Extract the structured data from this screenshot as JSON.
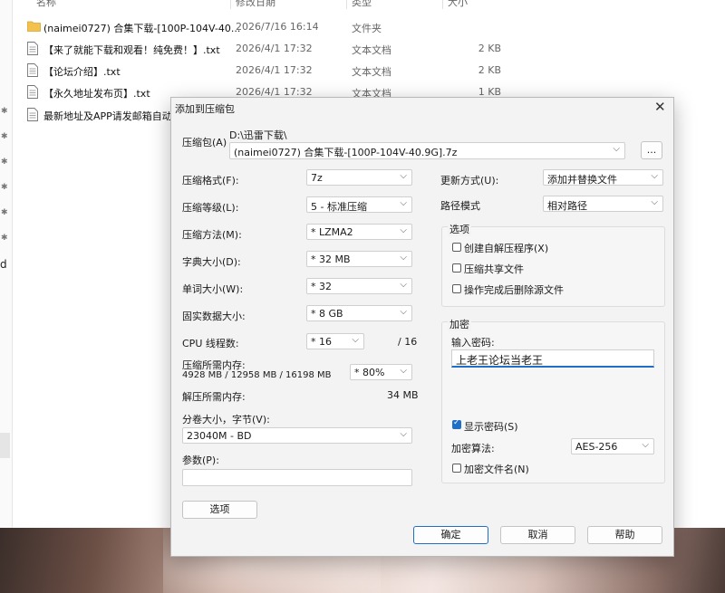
{
  "explorer": {
    "columns": {
      "name": "名称",
      "date": "修改日期",
      "type": "类型",
      "size": "大小"
    },
    "nav_letter": "d",
    "files": [
      {
        "name": "(naimei0727) 合集下载-[100P-104V-40...",
        "date": "2026/7/16 16:14",
        "type": "文件夹",
        "size": "",
        "icon": "folder-icon"
      },
      {
        "name": "【来了就能下载和观看！纯免费！】.txt",
        "date": "2026/4/1 17:32",
        "type": "文本文档",
        "size": "2 KB",
        "icon": "text-file-icon"
      },
      {
        "name": "【论坛介绍】.txt",
        "date": "2026/4/1 17:32",
        "type": "文本文档",
        "size": "2 KB",
        "icon": "text-file-icon"
      },
      {
        "name": "【永久地址发布页】.txt",
        "date": "2026/4/1 17:32",
        "type": "文本文档",
        "size": "1 KB",
        "icon": "text-file-icon"
      },
      {
        "name": "最新地址及APP请发邮箱自动",
        "date": "",
        "type": "",
        "size": "",
        "icon": "text-file-icon"
      }
    ]
  },
  "dialog": {
    "title": "添加到压缩包",
    "archive_label": "压缩包(A)",
    "archive_path": "D:\\迅雷下载\\",
    "archive_name": "(naimei0727) 合集下载-[100P-104V-40.9G].7z",
    "browse_label": "...",
    "left": [
      {
        "label": "压缩格式(F):",
        "value": "7z"
      },
      {
        "label": "压缩等级(L):",
        "value": "5 - 标准压缩"
      },
      {
        "label": "压缩方法(M):",
        "value": "* LZMA2"
      },
      {
        "label": "字典大小(D):",
        "value": "* 32 MB"
      },
      {
        "label": "单词大小(W):",
        "value": "* 32"
      },
      {
        "label": "固实数据大小:",
        "value": "* 8 GB"
      }
    ],
    "cpu_label": "CPU 线程数:",
    "cpu_value": "* 16",
    "cpu_total": "/ 16",
    "mem_compress_label": "压缩所需内存:",
    "mem_compress_detail": "4928 MB / 12958 MB / 16198 MB",
    "mem_percent": "* 80%",
    "mem_decompress_label": "解压所需内存:",
    "mem_decompress_value": "34 MB",
    "split_label": "分卷大小，字节(V):",
    "split_value": "23040M - BD",
    "params_label": "参数(P):",
    "params_value": "",
    "options_button": "选项",
    "update_label": "更新方式(U):",
    "update_value": "添加并替换文件",
    "path_label": "路径模式",
    "path_value": "相对路径",
    "options_group": "选项",
    "opt_sfx": "创建自解压程序(X)",
    "opt_shared": "压缩共享文件",
    "opt_delete": "操作完成后删除源文件",
    "encrypt_group": "加密",
    "password_label": "输入密码:",
    "password_value": "上老王论坛当老王",
    "show_password": "显示密码(S)",
    "enc_method_label": "加密算法:",
    "enc_method_value": "AES-256",
    "encrypt_names": "加密文件名(N)",
    "ok": "确定",
    "cancel": "取消",
    "help": "帮助"
  },
  "colors": {
    "accent": "#1f6fc6",
    "folder": "#f2c14e"
  }
}
